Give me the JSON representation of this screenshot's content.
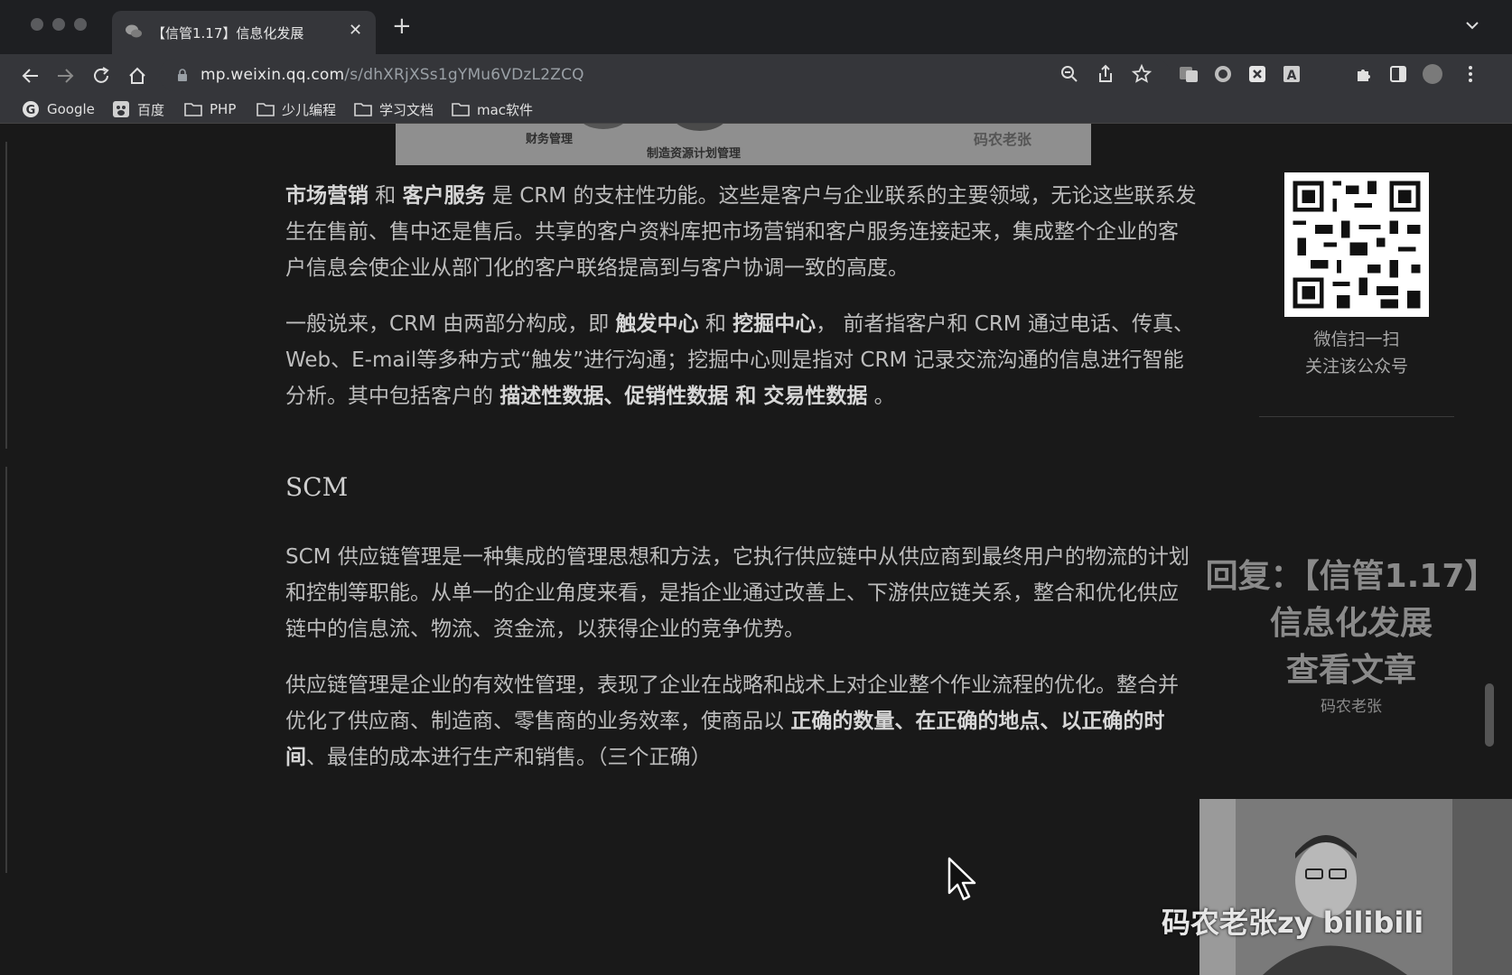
{
  "browser": {
    "tab": {
      "title": "【信管1.17】信息化发展"
    },
    "url": {
      "host": "mp.weixin.qq.com",
      "path": "/s/dhXRjXSs1gYMu6VDzL2ZCQ"
    },
    "bookmarks": [
      {
        "label": "Google",
        "icon": "google-icon"
      },
      {
        "label": "百度",
        "icon": "baidu-icon"
      },
      {
        "label": "PHP",
        "icon": "folder-icon"
      },
      {
        "label": "少儿编程",
        "icon": "folder-icon"
      },
      {
        "label": "学习文档",
        "icon": "folder-icon"
      },
      {
        "label": "mac软件",
        "icon": "folder-icon"
      }
    ]
  },
  "image_strip": {
    "labels": [
      "财务管理",
      "制造资源计划管理",
      "码农老张"
    ]
  },
  "article": {
    "p1": [
      {
        "t": "市场营销",
        "b": true
      },
      {
        "t": " 和 ",
        "b": false
      },
      {
        "t": "客户服务",
        "b": true
      },
      {
        "t": " 是 CRM 的支柱性功能。这些是客户与企业联系的主要领域，无论这些联系发生在售前、售中还是售后。共享的客户资料库把市场营销和客户服务连接起来，集成整个企业的客户信息会使企业从部门化的客户联络提高到与客户协调一致的高度。",
        "b": false
      }
    ],
    "p2": [
      {
        "t": "一般说来，CRM 由两部分构成，即 ",
        "b": false
      },
      {
        "t": "触发中心",
        "b": true
      },
      {
        "t": " 和 ",
        "b": false
      },
      {
        "t": "挖掘中心",
        "b": true
      },
      {
        "t": "， 前者指客户和 CRM 通过电话、传真、Web、E-mail等多种方式“触发”进行沟通；挖掘中心则是指对 CRM 记录交流沟通的信息进行智能分析。其中包括客户的 ",
        "b": false
      },
      {
        "t": "描述性数据、促销性数据 和 交易性数据",
        "b": true
      },
      {
        "t": " 。",
        "b": false
      }
    ],
    "heading_scm": "SCM",
    "p3": [
      {
        "t": "SCM 供应链管理是一种集成的管理思想和方法，它执行供应链中从供应商到最终用户的物流的计划和控制等职能。从单一的企业角度来看，是指企业通过改善上、下游供应链关系，整合和优化供应链中的信息流、物流、资金流，以获得企业的竞争优势。",
        "b": false
      }
    ],
    "p4": [
      {
        "t": "供应链管理是企业的有效性管理，表现了企业在战略和战术上对企业整个作业流程的优化。整合并优化了供应商、制造商、零售商的业务效率，使商品以 ",
        "b": false
      },
      {
        "t": "正确的数量、在正确的地点、以正确的时间",
        "b": true
      },
      {
        "t": "、最佳的成本进行生产和销售。（三个正确）",
        "b": false
      }
    ]
  },
  "sidebar": {
    "qr_caption_1": "微信扫一扫",
    "qr_caption_2": "关注该公众号"
  },
  "overlay": {
    "line1": "回复：【信管1.17】",
    "line2": "信息化发展",
    "line3": "查看文章",
    "line4": "码农老张"
  },
  "watermark": "码农老张zy bilibili"
}
